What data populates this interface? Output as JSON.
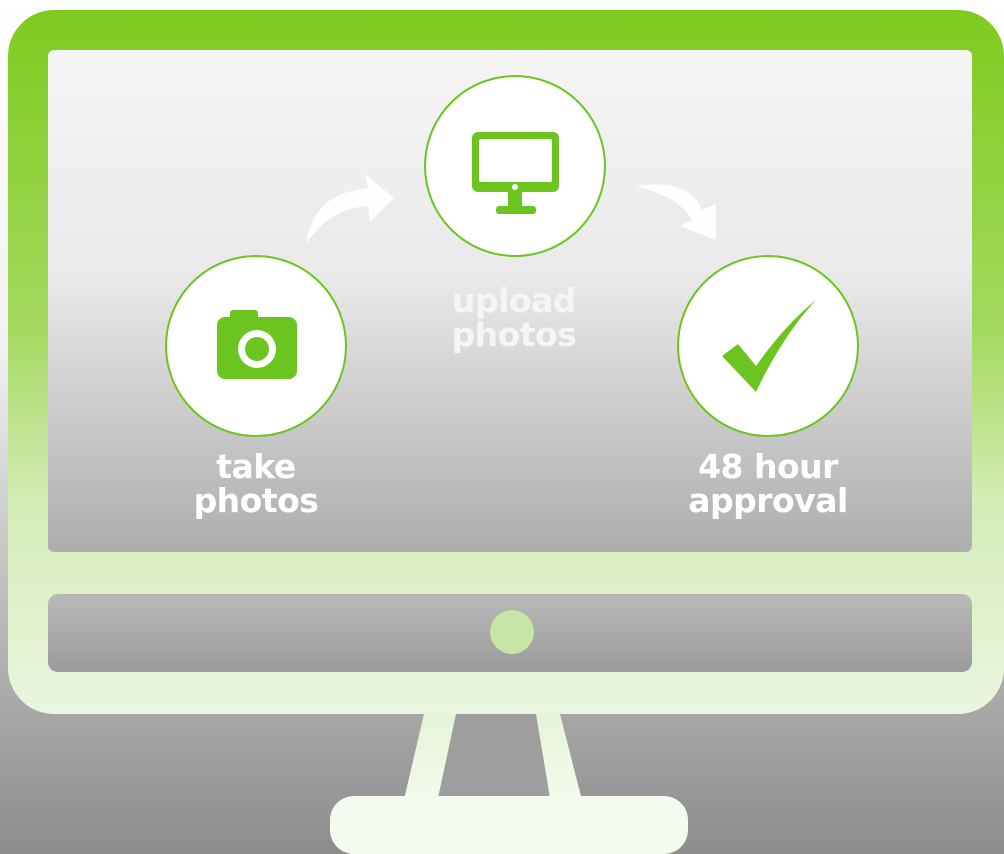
{
  "colors": {
    "frame_green_top": "#7ecb1f",
    "frame_green_bottom": "#eaf5df",
    "accent_green": "#6cc51f",
    "circle_fill": "#ffffff",
    "label_text": "#ffffff"
  },
  "steps": [
    {
      "icon": "camera-icon",
      "label_line1": "take",
      "label_line2": "photos"
    },
    {
      "icon": "monitor-icon",
      "label_line1": "upload",
      "label_line2": "photos"
    },
    {
      "icon": "checkmark-icon",
      "label_line1": "48 hour",
      "label_line2": "approval"
    }
  ],
  "connectors": [
    {
      "icon": "curved-arrow-up-right-icon"
    },
    {
      "icon": "curved-arrow-down-right-icon"
    }
  ]
}
